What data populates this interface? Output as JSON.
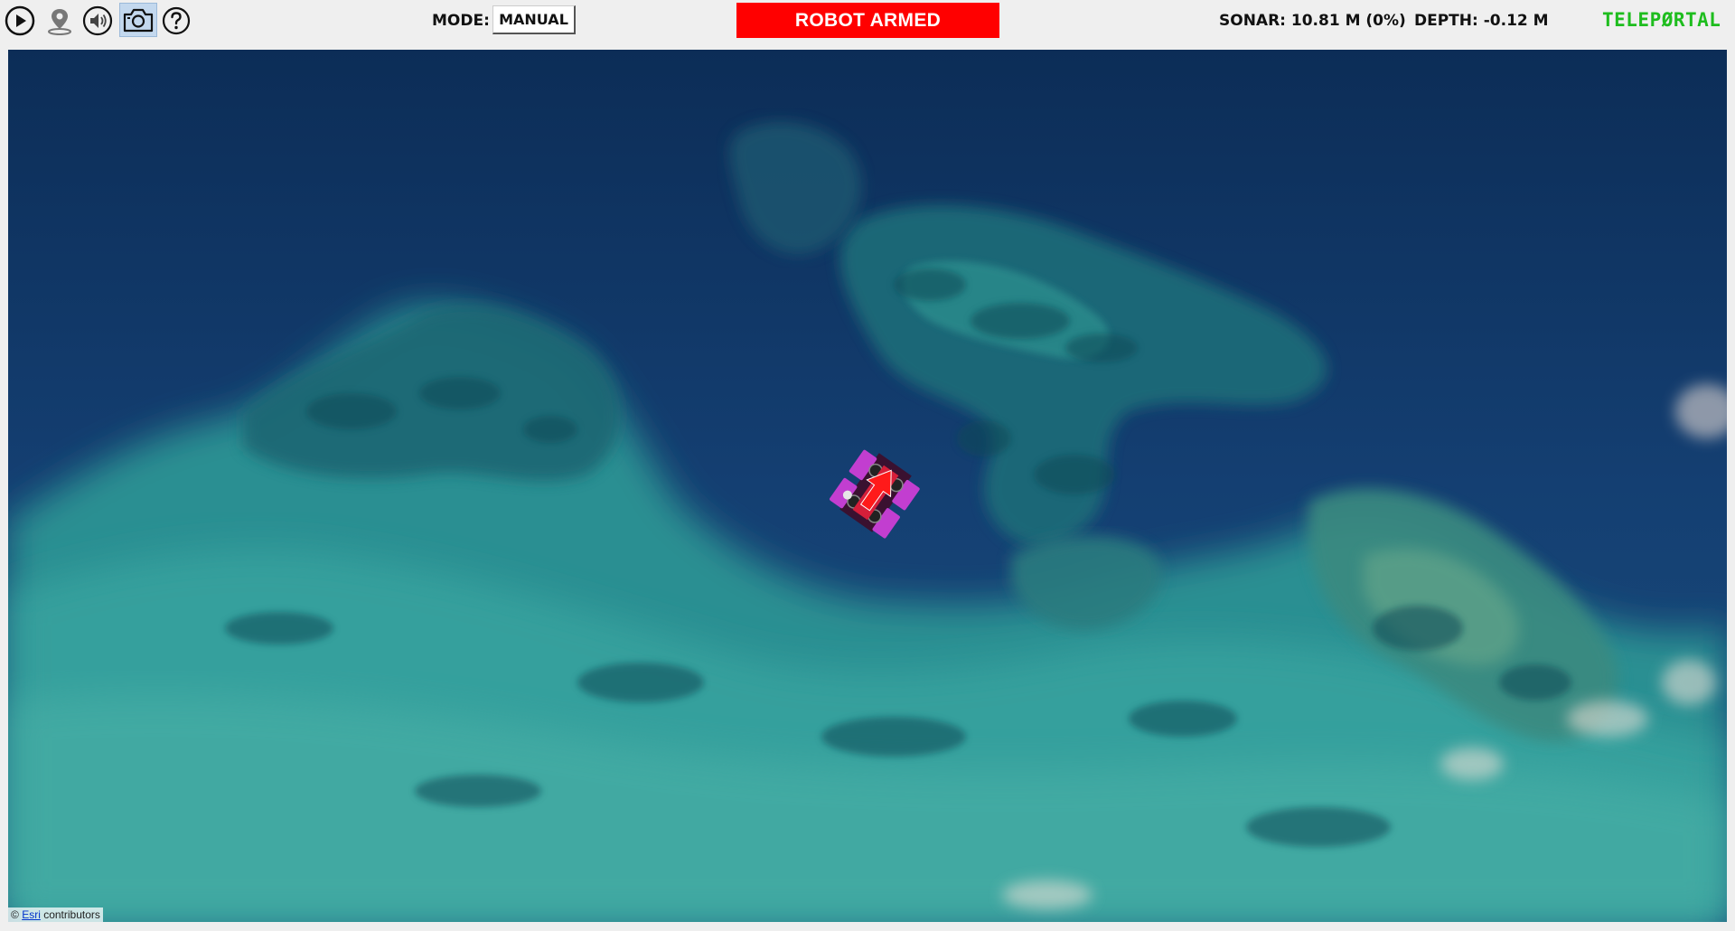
{
  "toolbar": {
    "icons": [
      "play-icon",
      "location-pin-icon",
      "speaker-icon",
      "camera-icon",
      "help-icon"
    ],
    "active_icon": "camera-icon",
    "mode_label": "MODE:",
    "mode_value": "MANUAL",
    "armed_status": "ROBOT ARMED",
    "armed_color": "#ff0000",
    "sonar": "SONAR: 10.81 M (0%)",
    "depth": "DEPTH: -0.12 M",
    "brand": "TELEPØRTAL",
    "brand_color": "#1ebd1e"
  },
  "map": {
    "attribution_prefix": "©",
    "attribution_link": "Esri",
    "attribution_suffix": "contributors"
  }
}
